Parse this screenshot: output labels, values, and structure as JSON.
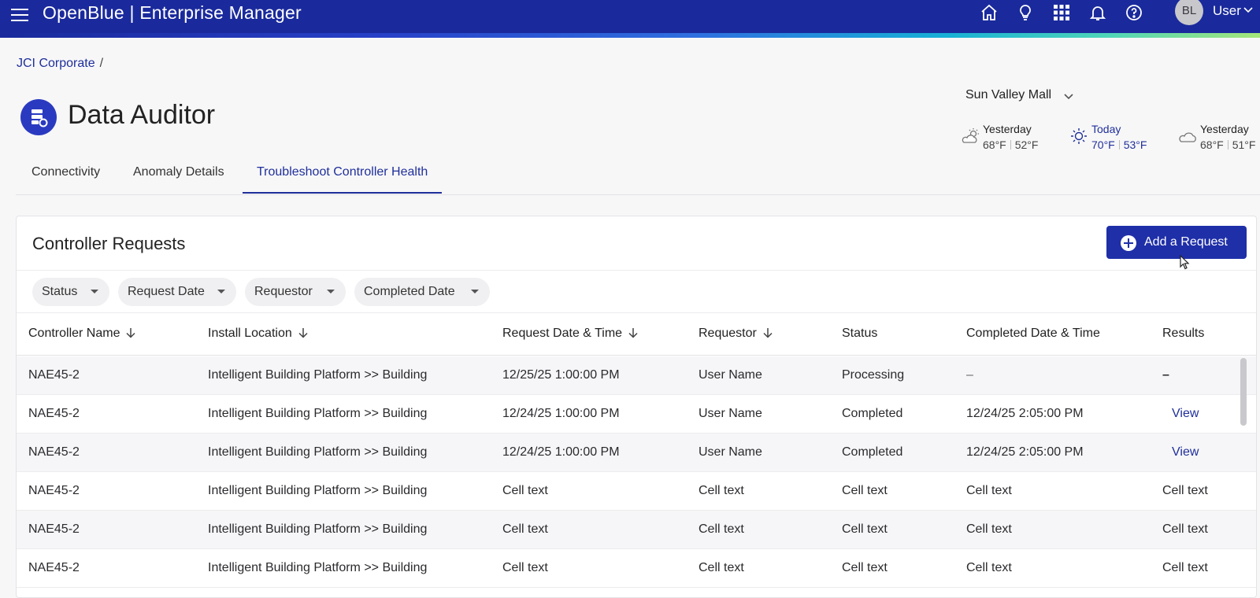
{
  "app": {
    "title": "OpenBlue | Enterprise Manager"
  },
  "header_icons": [
    "home-icon",
    "lightbulb-icon",
    "apps-grid-icon",
    "bell-icon",
    "help-icon"
  ],
  "user": {
    "initials": "BL",
    "label": "User"
  },
  "breadcrumb": {
    "root": "JCI Corporate",
    "separator": "/"
  },
  "page": {
    "title": "Data Auditor"
  },
  "site": {
    "selected": "Sun Valley Mall"
  },
  "weather": [
    {
      "day": "Yesterday",
      "high": "68°F",
      "low": "52°F",
      "icon": "partly-cloudy-icon"
    },
    {
      "day": "Today",
      "high": "70°F",
      "low": "53°F",
      "icon": "sun-icon"
    },
    {
      "day": "Yesterday",
      "high": "68°F",
      "low": "51°F",
      "icon": "cloud-icon"
    }
  ],
  "tabs": [
    {
      "label": "Connectivity",
      "active": false
    },
    {
      "label": "Anomaly Details",
      "active": false
    },
    {
      "label": "Troubleshoot Controller Health",
      "active": true
    }
  ],
  "card": {
    "title": "Controller Requests",
    "add_button": "Add a Request"
  },
  "filters": [
    "Status",
    "Request Date",
    "Requestor",
    "Completed Date"
  ],
  "table": {
    "columns": [
      "Controller Name",
      "Install Location",
      "Request Date & Time",
      "Requestor",
      "Status",
      "Completed Date & Time",
      "Results"
    ],
    "rows": [
      [
        "NAE45-2",
        "Intelligent Building Platform >> Building",
        "12/25/25 1:00:00 PM",
        "User Name",
        "Processing",
        "–",
        "–"
      ],
      [
        "NAE45-2",
        "Intelligent Building Platform >> Building",
        "12/24/25 1:00:00 PM",
        "User Name",
        "Completed",
        "12/24/25 2:05:00 PM",
        "View"
      ],
      [
        "NAE45-2",
        "Intelligent Building Platform >> Building",
        "12/24/25 1:00:00 PM",
        "User Name",
        "Completed",
        "12/24/25 2:05:00 PM",
        "View"
      ],
      [
        "NAE45-2",
        "Intelligent Building Platform >> Building",
        "Cell text",
        "Cell text",
        "Cell text",
        "Cell text",
        "Cell text"
      ],
      [
        "NAE45-2",
        "Intelligent Building Platform >> Building",
        "Cell text",
        "Cell text",
        "Cell text",
        "Cell text",
        "Cell text"
      ],
      [
        "NAE45-2",
        "Intelligent Building Platform >> Building",
        "Cell text",
        "Cell text",
        "Cell text",
        "Cell text",
        "Cell text"
      ]
    ]
  },
  "colors": {
    "brand": "#1a2a9c",
    "accent": "#1f2fa8",
    "link": "#1f2f9a"
  }
}
